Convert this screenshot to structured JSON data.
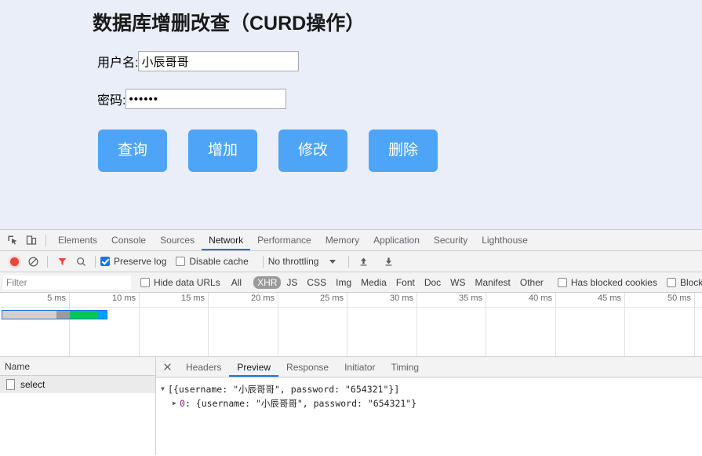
{
  "page": {
    "title": "数据库增删改查（CURD操作）",
    "username_label": "用户名:",
    "username_value": "小辰哥哥",
    "username_placeholder": "",
    "password_label": "密码:",
    "password_value": "••••••",
    "password_placeholder": "",
    "buttons": [
      {
        "label": "查询",
        "name": "query-button"
      },
      {
        "label": "增加",
        "name": "add-button"
      },
      {
        "label": "修改",
        "name": "modify-button"
      },
      {
        "label": "删除",
        "name": "delete-button"
      }
    ],
    "accent_color": "#4ea4f6",
    "background_color": "#eaeef8"
  },
  "devtools": {
    "tabs": [
      {
        "label": "Elements",
        "active": false
      },
      {
        "label": "Console",
        "active": false
      },
      {
        "label": "Sources",
        "active": false
      },
      {
        "label": "Network",
        "active": true
      },
      {
        "label": "Performance",
        "active": false
      },
      {
        "label": "Memory",
        "active": false
      },
      {
        "label": "Application",
        "active": false
      },
      {
        "label": "Security",
        "active": false
      },
      {
        "label": "Lighthouse",
        "active": false
      }
    ],
    "controls": {
      "preserve_log_label": "Preserve log",
      "preserve_log_checked": true,
      "disable_cache_label": "Disable cache",
      "disable_cache_checked": false,
      "throttling_label": "No throttling"
    },
    "filterbar": {
      "filter_placeholder": "Filter",
      "filter_value": "",
      "hide_data_urls_label": "Hide data URLs",
      "hide_data_urls_checked": false,
      "types": [
        {
          "label": "All",
          "selected": false
        },
        {
          "label": "XHR",
          "selected": true
        },
        {
          "label": "JS",
          "selected": false
        },
        {
          "label": "CSS",
          "selected": false
        },
        {
          "label": "Img",
          "selected": false
        },
        {
          "label": "Media",
          "selected": false
        },
        {
          "label": "Font",
          "selected": false
        },
        {
          "label": "Doc",
          "selected": false
        },
        {
          "label": "WS",
          "selected": false
        },
        {
          "label": "Manifest",
          "selected": false
        },
        {
          "label": "Other",
          "selected": false
        }
      ],
      "has_blocked_cookies_label": "Has blocked cookies",
      "has_blocked_cookies_checked": false,
      "blocked_requests_label": "Blocked Reque",
      "blocked_requests_checked": false
    },
    "timeline": {
      "ticks": [
        "5 ms",
        "10 ms",
        "15 ms",
        "20 ms",
        "25 ms",
        "30 ms",
        "35 ms",
        "40 ms",
        "45 ms",
        "50 ms"
      ],
      "waterfall_segments": [
        {
          "color": "#d4cfcb",
          "width_pct": 52
        },
        {
          "color": "#9b9b9b",
          "width_pct": 13
        },
        {
          "color": "#00c853",
          "width_pct": 27
        },
        {
          "color": "#00a0ff",
          "width_pct": 8
        }
      ]
    },
    "requests": {
      "column_header": "Name",
      "rows": [
        {
          "name": "select"
        }
      ]
    },
    "detail": {
      "tabs": [
        {
          "label": "Headers",
          "active": false
        },
        {
          "label": "Preview",
          "active": true
        },
        {
          "label": "Response",
          "active": false
        },
        {
          "label": "Initiator",
          "active": false
        },
        {
          "label": "Timing",
          "active": false
        }
      ],
      "preview_lines": [
        {
          "triangle": "▼",
          "indent": false,
          "prefix": "",
          "text": "[{username: \"小辰哥哥\", password: \"654321\"}]"
        },
        {
          "triangle": "▶",
          "indent": true,
          "prefix": "0",
          "text": ": {username: \"小辰哥哥\", password: \"654321\"}"
        }
      ]
    }
  }
}
